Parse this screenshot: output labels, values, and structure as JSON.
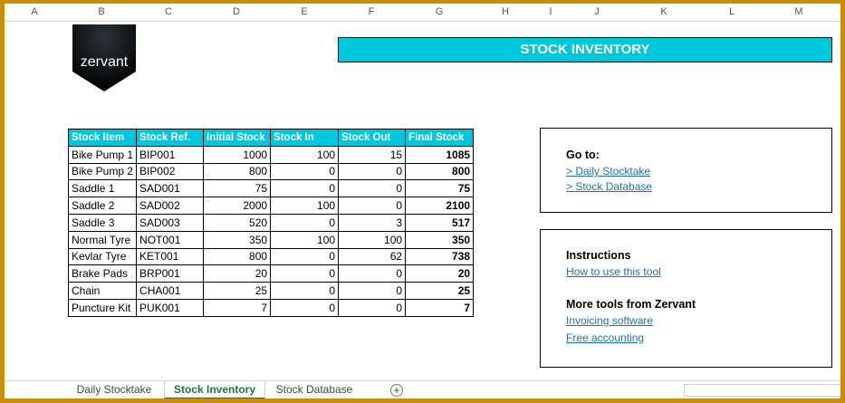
{
  "columns": [
    "A",
    "B",
    "C",
    "D",
    "E",
    "F",
    "G",
    "H",
    "I",
    "J",
    "K",
    "L",
    "M"
  ],
  "logo": {
    "text": "zervant"
  },
  "title": "STOCK INVENTORY",
  "table": {
    "headers": [
      "Stock Item",
      "Stock Ref.",
      "Initial Stock",
      "Stock In",
      "Stock Out",
      "Final Stock"
    ],
    "rows": [
      [
        "Bike Pump 1",
        "BIP001",
        "1000",
        "100",
        "15",
        "1085"
      ],
      [
        "Bike Pump 2",
        "BIP002",
        "800",
        "0",
        "0",
        "800"
      ],
      [
        "Saddle 1",
        "SAD001",
        "75",
        "0",
        "0",
        "75"
      ],
      [
        "Saddle 2",
        "SAD002",
        "2000",
        "100",
        "0",
        "2100"
      ],
      [
        "Saddle 3",
        "SAD003",
        "520",
        "0",
        "3",
        "517"
      ],
      [
        "Normal Tyre",
        "NOT001",
        "350",
        "100",
        "100",
        "350"
      ],
      [
        "Kevlar Tyre",
        "KET001",
        "800",
        "0",
        "62",
        "738"
      ],
      [
        "Brake Pads",
        "BRP001",
        "20",
        "0",
        "0",
        "20"
      ],
      [
        "Chain",
        "CHA001",
        "25",
        "0",
        "0",
        "25"
      ],
      [
        "Puncture Kit",
        "PUK001",
        "7",
        "0",
        "0",
        "7"
      ]
    ]
  },
  "goto": {
    "heading": "Go to:",
    "links": [
      "> Daily Stocktake",
      "> Stock Database"
    ]
  },
  "instructions": {
    "heading": "Instructions",
    "link": "How to use this tool",
    "more_heading": "More tools from Zervant",
    "more_links": [
      "Invoicing software",
      "Free accounting"
    ]
  },
  "tabs": [
    {
      "label": "Daily Stocktake",
      "active": false
    },
    {
      "label": "Stock Inventory",
      "active": true
    },
    {
      "label": "Stock Database",
      "active": false
    }
  ],
  "add_sheet": "+",
  "colors": {
    "accent": "#00c8dc",
    "active_tab": "#217346",
    "frame": "#c8900a",
    "link": "#1f6fb8"
  }
}
